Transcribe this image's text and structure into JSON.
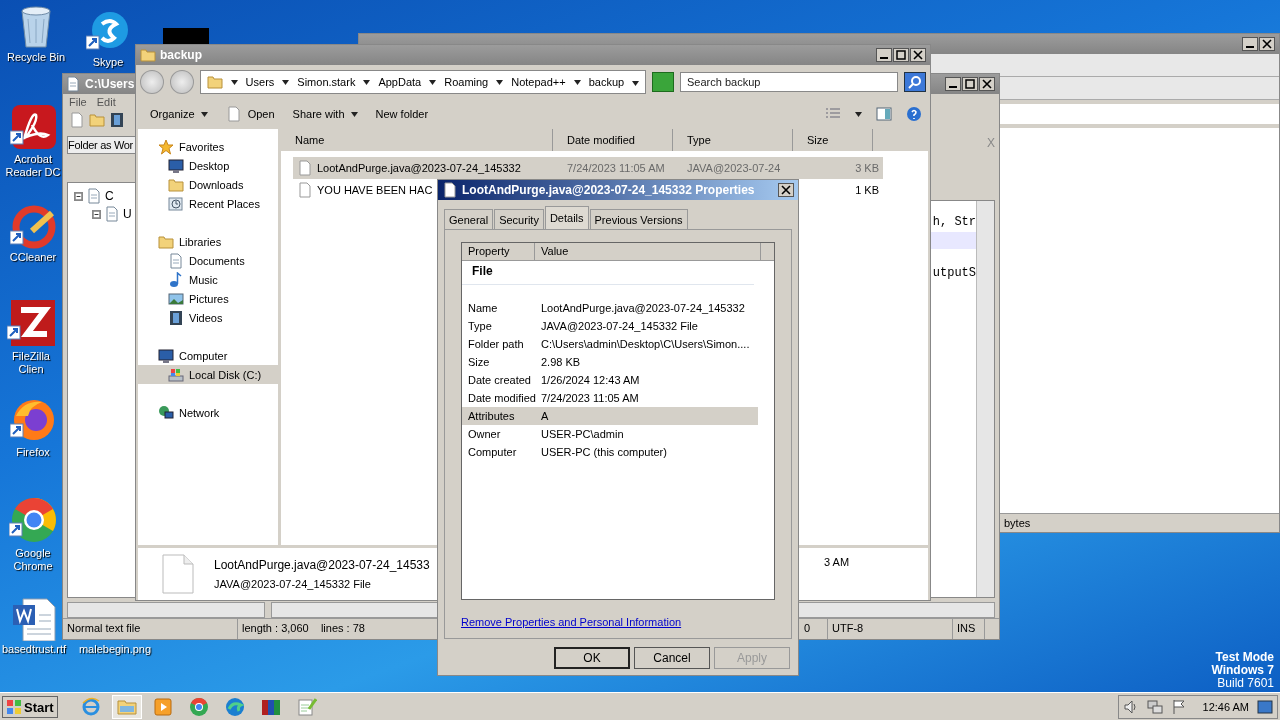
{
  "desktop_icons": [
    {
      "label": "Recycle Bin",
      "kind": "trash",
      "shortcut": false
    },
    {
      "label": "Skype",
      "kind": "chat",
      "shortcut": true
    },
    {
      "label": "Acrobat Reader DC",
      "kind": "pdf",
      "shortcut": true
    },
    {
      "label": "CCleaner",
      "kind": "brush",
      "shortcut": true
    },
    {
      "label": "FileZilla Clien",
      "kind": "zigzag",
      "shortcut": true
    },
    {
      "label": "Firefox",
      "kind": "fox",
      "shortcut": true
    },
    {
      "label": "Google Chrome",
      "kind": "ring",
      "shortcut": true
    },
    {
      "label": "basedtrust.rtf",
      "kind": "doc",
      "shortcut": false
    },
    {
      "label": "malebegin.png",
      "kind": "hidden"
    }
  ],
  "back_window": {
    "status": "bytes"
  },
  "notepad": {
    "title": "C:\\Users",
    "menu": [
      "File",
      "Edit"
    ],
    "panel_title": "Folder as Wor",
    "tree": [
      {
        "label": "C",
        "expanded": true,
        "children": [
          {
            "label": "U",
            "expanded": true
          }
        ]
      }
    ],
    "tab_close": "X",
    "code_lines": [
      "h, Str",
      "utputS"
    ],
    "status": [
      "Normal text file",
      "length : 3,060    lines : 78",
      "0",
      "UTF-8",
      "INS"
    ]
  },
  "explorer": {
    "title": "backup",
    "breadcrumb": [
      "Users",
      "Simon.stark",
      "AppData",
      "Roaming",
      "Notepad++",
      "backup"
    ],
    "search": {
      "placeholder": "Search backup"
    },
    "toolbar": [
      {
        "label": "Organize",
        "dropdown": true,
        "kind": "plain"
      },
      {
        "label": "Open",
        "dropdown": false,
        "kind": "file"
      },
      {
        "label": "Share with",
        "dropdown": true,
        "kind": "plain"
      },
      {
        "label": "New folder",
        "dropdown": false,
        "kind": "plain"
      }
    ],
    "nav": [
      {
        "label": "Favorites",
        "kind": "star",
        "selected": false,
        "children": [
          {
            "label": "Desktop",
            "kind": "monitor",
            "selected": false
          },
          {
            "label": "Downloads",
            "kind": "folder",
            "selected": false
          },
          {
            "label": "Recent Places",
            "kind": "clock",
            "selected": false
          }
        ]
      },
      {
        "label": "Libraries",
        "kind": "folder",
        "selected": false,
        "children": [
          {
            "label": "Documents",
            "kind": "doc",
            "selected": false
          },
          {
            "label": "Music",
            "kind": "note",
            "selected": false
          },
          {
            "label": "Pictures",
            "kind": "photo",
            "selected": false
          },
          {
            "label": "Videos",
            "kind": "film",
            "selected": false
          }
        ]
      },
      {
        "label": "Computer",
        "kind": "monitor",
        "selected": false,
        "children": [
          {
            "label": "Local Disk (C:)",
            "kind": "disk",
            "selected": true
          }
        ]
      },
      {
        "label": "Network",
        "kind": "globe",
        "selected": false
      }
    ],
    "columns": [
      "Name",
      "Date modified",
      "Type",
      "Size"
    ],
    "rows": [
      {
        "name": "LootAndPurge.java@2023-07-24_145332",
        "date": "7/24/2023 11:05 AM",
        "type": "JAVA@2023-07-24",
        "size": "3 KB",
        "selected": true
      },
      {
        "name": "YOU HAVE BEEN HAC",
        "size": "1 KB",
        "selected": false
      }
    ],
    "details": {
      "name": "LootAndPurge.java@2023-07-24_14533",
      "type": "JAVA@2023-07-24_145332 File",
      "extra": "3 AM"
    }
  },
  "dialog": {
    "title": "LootAndPurge.java@2023-07-24_145332 Properties",
    "tabs": [
      {
        "label": "General",
        "selected": false
      },
      {
        "label": "Security",
        "selected": false
      },
      {
        "label": "Details",
        "selected": true
      },
      {
        "label": "Previous Versions",
        "selected": false
      }
    ],
    "columns": [
      "Property",
      "Value"
    ],
    "group": "File",
    "properties": [
      {
        "property": "Name",
        "value": "LootAndPurge.java@2023-07-24_145332",
        "selected": false
      },
      {
        "property": "Type",
        "value": "JAVA@2023-07-24_145332 File",
        "selected": false
      },
      {
        "property": "Folder path",
        "value": "C:\\Users\\admin\\Desktop\\C\\Users\\Simon....",
        "selected": false
      },
      {
        "property": "Size",
        "value": "2.98 KB",
        "selected": false
      },
      {
        "property": "Date created",
        "value": "1/26/2024 12:43 AM",
        "selected": false
      },
      {
        "property": "Date modified",
        "value": "7/24/2023 11:05 AM",
        "selected": false
      },
      {
        "property": "Attributes",
        "value": "A",
        "selected": true
      },
      {
        "property": "Owner",
        "value": "USER-PC\\admin",
        "selected": false
      },
      {
        "property": "Computer",
        "value": "USER-PC (this computer)",
        "selected": false
      }
    ],
    "link": "Remove Properties and Personal Information",
    "buttons": [
      {
        "label": "OK",
        "disabled": false
      },
      {
        "label": "Cancel",
        "disabled": false
      },
      {
        "label": "Apply",
        "disabled": true
      }
    ]
  },
  "system_notice": [
    "Test Mode",
    "Windows 7",
    "Build 7601"
  ],
  "taskbar": {
    "start": "Start",
    "apps": [
      {
        "kind": "ie",
        "selected": false
      },
      {
        "kind": "folder",
        "selected": true
      },
      {
        "kind": "play",
        "selected": false
      },
      {
        "kind": "ring",
        "selected": false
      },
      {
        "kind": "wave",
        "selected": false
      },
      {
        "kind": "books",
        "selected": false
      },
      {
        "kind": "notepad",
        "selected": false
      }
    ],
    "clock": "12:46 AM"
  }
}
